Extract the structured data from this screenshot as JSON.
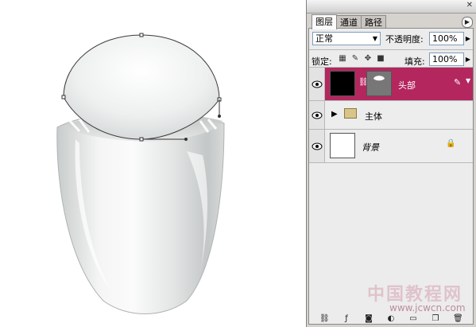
{
  "canvas": {
    "colors": {
      "shell_light": "#f6f7f7",
      "shell_dark": "#b9bcbc",
      "path": "#3b3b3b"
    }
  },
  "layers_panel": {
    "tabs": [
      {
        "label": "图层",
        "active": true
      },
      {
        "label": "通道",
        "active": false
      },
      {
        "label": "路径",
        "active": false
      }
    ],
    "blend_mode": "正常",
    "opacity_label": "不透明度:",
    "opacity_value": "100%",
    "lock_label": "锁定:",
    "fill_label": "填充:",
    "fill_value": "100%",
    "layers": [
      {
        "name": "头部",
        "selected": true,
        "visible": true,
        "type": "masked-layer",
        "icon": "brush-icon"
      },
      {
        "name": "主体",
        "selected": false,
        "visible": true,
        "type": "group",
        "icon": "folder-icon"
      },
      {
        "name": "背景",
        "selected": false,
        "visible": true,
        "type": "background",
        "icon": "lock-icon"
      }
    ],
    "colors": {
      "selected_row": "#b3265e",
      "panel_bg": "#d6d3ce",
      "list_bg": "#ececec"
    }
  },
  "watermark": {
    "text": "中国教程网",
    "url": "www.jcwcn.com"
  }
}
